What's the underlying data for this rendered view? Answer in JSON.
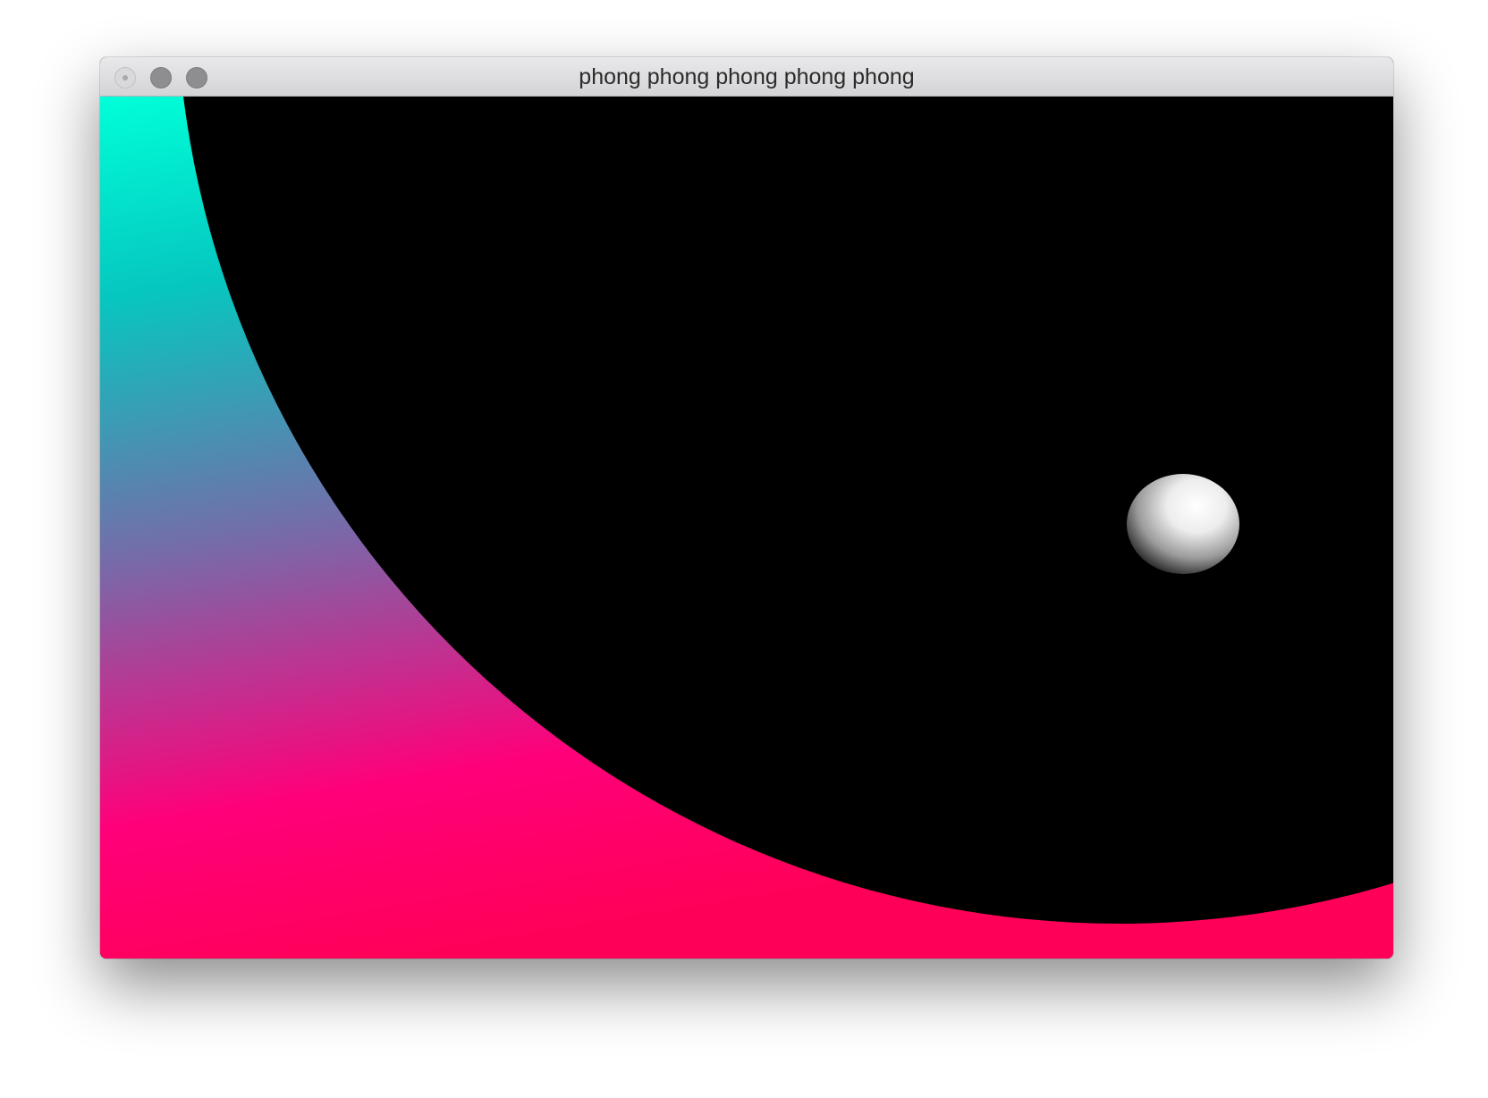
{
  "window": {
    "title": "phong phong phong phong phong",
    "controls": {
      "close": "close-icon",
      "minimize": "minimize-icon",
      "maximize": "maximize-icon"
    }
  },
  "scene": {
    "background": "#000000",
    "gradient_colors": {
      "top": "#00ffd8",
      "upper_mid": "#06c7c0",
      "middle": "#7a68a8",
      "lower": "#ff007a",
      "bottom": "#ff0058"
    },
    "sphere": {
      "color": "#ffffff",
      "shading": "phong"
    }
  }
}
